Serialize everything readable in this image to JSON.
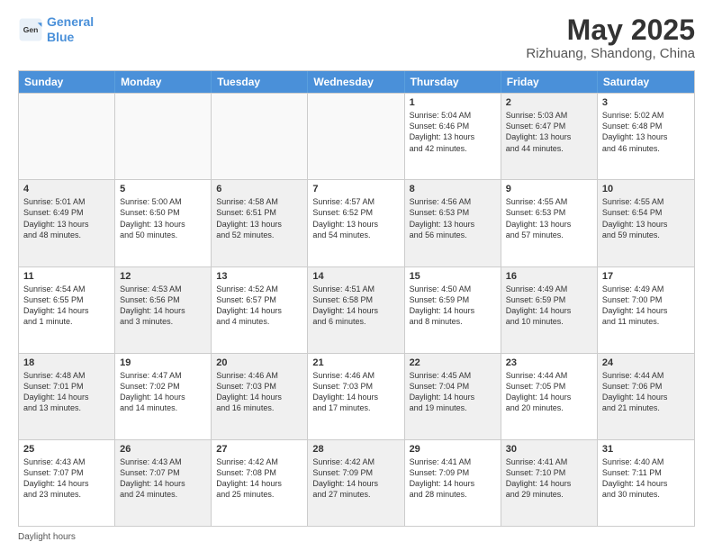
{
  "header": {
    "logo_line1": "General",
    "logo_line2": "Blue",
    "title": "May 2025",
    "subtitle": "Rizhuang, Shandong, China"
  },
  "days_of_week": [
    "Sunday",
    "Monday",
    "Tuesday",
    "Wednesday",
    "Thursday",
    "Friday",
    "Saturday"
  ],
  "footer_text": "Daylight hours",
  "weeks": [
    [
      {
        "day": "",
        "text": "",
        "shaded": true
      },
      {
        "day": "",
        "text": "",
        "shaded": true
      },
      {
        "day": "",
        "text": "",
        "shaded": true
      },
      {
        "day": "",
        "text": "",
        "shaded": true
      },
      {
        "day": "1",
        "text": "Sunrise: 5:04 AM\nSunset: 6:46 PM\nDaylight: 13 hours\nand 42 minutes.",
        "shaded": false
      },
      {
        "day": "2",
        "text": "Sunrise: 5:03 AM\nSunset: 6:47 PM\nDaylight: 13 hours\nand 44 minutes.",
        "shaded": true
      },
      {
        "day": "3",
        "text": "Sunrise: 5:02 AM\nSunset: 6:48 PM\nDaylight: 13 hours\nand 46 minutes.",
        "shaded": false
      }
    ],
    [
      {
        "day": "4",
        "text": "Sunrise: 5:01 AM\nSunset: 6:49 PM\nDaylight: 13 hours\nand 48 minutes.",
        "shaded": true
      },
      {
        "day": "5",
        "text": "Sunrise: 5:00 AM\nSunset: 6:50 PM\nDaylight: 13 hours\nand 50 minutes.",
        "shaded": false
      },
      {
        "day": "6",
        "text": "Sunrise: 4:58 AM\nSunset: 6:51 PM\nDaylight: 13 hours\nand 52 minutes.",
        "shaded": true
      },
      {
        "day": "7",
        "text": "Sunrise: 4:57 AM\nSunset: 6:52 PM\nDaylight: 13 hours\nand 54 minutes.",
        "shaded": false
      },
      {
        "day": "8",
        "text": "Sunrise: 4:56 AM\nSunset: 6:53 PM\nDaylight: 13 hours\nand 56 minutes.",
        "shaded": true
      },
      {
        "day": "9",
        "text": "Sunrise: 4:55 AM\nSunset: 6:53 PM\nDaylight: 13 hours\nand 57 minutes.",
        "shaded": false
      },
      {
        "day": "10",
        "text": "Sunrise: 4:55 AM\nSunset: 6:54 PM\nDaylight: 13 hours\nand 59 minutes.",
        "shaded": true
      }
    ],
    [
      {
        "day": "11",
        "text": "Sunrise: 4:54 AM\nSunset: 6:55 PM\nDaylight: 14 hours\nand 1 minute.",
        "shaded": false
      },
      {
        "day": "12",
        "text": "Sunrise: 4:53 AM\nSunset: 6:56 PM\nDaylight: 14 hours\nand 3 minutes.",
        "shaded": true
      },
      {
        "day": "13",
        "text": "Sunrise: 4:52 AM\nSunset: 6:57 PM\nDaylight: 14 hours\nand 4 minutes.",
        "shaded": false
      },
      {
        "day": "14",
        "text": "Sunrise: 4:51 AM\nSunset: 6:58 PM\nDaylight: 14 hours\nand 6 minutes.",
        "shaded": true
      },
      {
        "day": "15",
        "text": "Sunrise: 4:50 AM\nSunset: 6:59 PM\nDaylight: 14 hours\nand 8 minutes.",
        "shaded": false
      },
      {
        "day": "16",
        "text": "Sunrise: 4:49 AM\nSunset: 6:59 PM\nDaylight: 14 hours\nand 10 minutes.",
        "shaded": true
      },
      {
        "day": "17",
        "text": "Sunrise: 4:49 AM\nSunset: 7:00 PM\nDaylight: 14 hours\nand 11 minutes.",
        "shaded": false
      }
    ],
    [
      {
        "day": "18",
        "text": "Sunrise: 4:48 AM\nSunset: 7:01 PM\nDaylight: 14 hours\nand 13 minutes.",
        "shaded": true
      },
      {
        "day": "19",
        "text": "Sunrise: 4:47 AM\nSunset: 7:02 PM\nDaylight: 14 hours\nand 14 minutes.",
        "shaded": false
      },
      {
        "day": "20",
        "text": "Sunrise: 4:46 AM\nSunset: 7:03 PM\nDaylight: 14 hours\nand 16 minutes.",
        "shaded": true
      },
      {
        "day": "21",
        "text": "Sunrise: 4:46 AM\nSunset: 7:03 PM\nDaylight: 14 hours\nand 17 minutes.",
        "shaded": false
      },
      {
        "day": "22",
        "text": "Sunrise: 4:45 AM\nSunset: 7:04 PM\nDaylight: 14 hours\nand 19 minutes.",
        "shaded": true
      },
      {
        "day": "23",
        "text": "Sunrise: 4:44 AM\nSunset: 7:05 PM\nDaylight: 14 hours\nand 20 minutes.",
        "shaded": false
      },
      {
        "day": "24",
        "text": "Sunrise: 4:44 AM\nSunset: 7:06 PM\nDaylight: 14 hours\nand 21 minutes.",
        "shaded": true
      }
    ],
    [
      {
        "day": "25",
        "text": "Sunrise: 4:43 AM\nSunset: 7:07 PM\nDaylight: 14 hours\nand 23 minutes.",
        "shaded": false
      },
      {
        "day": "26",
        "text": "Sunrise: 4:43 AM\nSunset: 7:07 PM\nDaylight: 14 hours\nand 24 minutes.",
        "shaded": true
      },
      {
        "day": "27",
        "text": "Sunrise: 4:42 AM\nSunset: 7:08 PM\nDaylight: 14 hours\nand 25 minutes.",
        "shaded": false
      },
      {
        "day": "28",
        "text": "Sunrise: 4:42 AM\nSunset: 7:09 PM\nDaylight: 14 hours\nand 27 minutes.",
        "shaded": true
      },
      {
        "day": "29",
        "text": "Sunrise: 4:41 AM\nSunset: 7:09 PM\nDaylight: 14 hours\nand 28 minutes.",
        "shaded": false
      },
      {
        "day": "30",
        "text": "Sunrise: 4:41 AM\nSunset: 7:10 PM\nDaylight: 14 hours\nand 29 minutes.",
        "shaded": true
      },
      {
        "day": "31",
        "text": "Sunrise: 4:40 AM\nSunset: 7:11 PM\nDaylight: 14 hours\nand 30 minutes.",
        "shaded": false
      }
    ]
  ]
}
